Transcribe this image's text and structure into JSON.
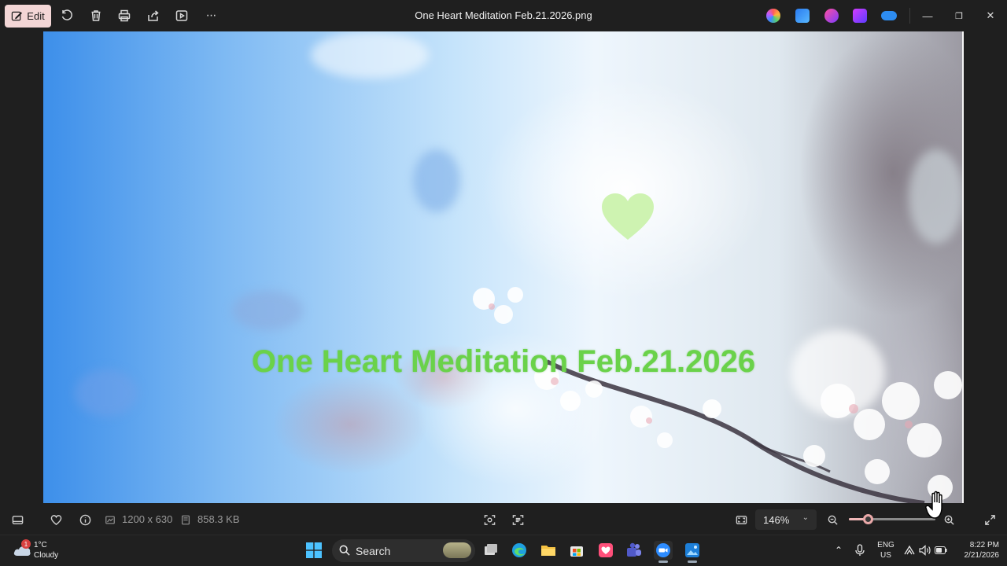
{
  "window": {
    "title": "One Heart Meditation Feb.21.2026.png",
    "edit_label": "Edit"
  },
  "toolbar": {
    "more_label": "···"
  },
  "image": {
    "overlay_text": "One Heart Meditation Feb.21.2026",
    "overlay_color": "#6ad24a",
    "heart_color": "#c9f2a8"
  },
  "status": {
    "dimensions": "1200 x 630",
    "file_size": "858.3 KB",
    "zoom_value": "146%",
    "zoom_slider_fraction": 0.22
  },
  "taskbar": {
    "weather_temp": "1°C",
    "weather_condition": "Cloudy",
    "weather_badge": "1",
    "search_label": "Search",
    "language_line1": "ENG",
    "language_line2": "US",
    "time": "8:22 PM",
    "date": "2/21/2026"
  },
  "colors": {
    "edit_button_bg": "#f3d6d6",
    "accent": "#e9a8a8"
  }
}
